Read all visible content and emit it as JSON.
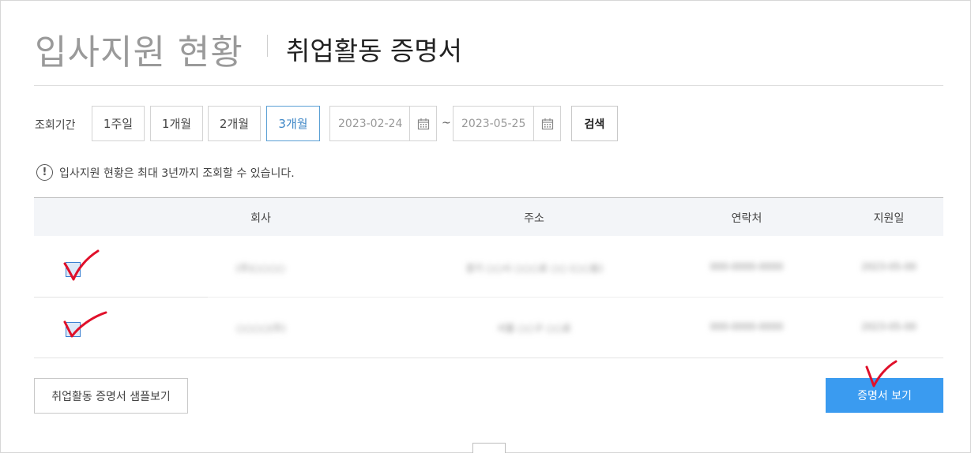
{
  "header": {
    "title": "입사지원 현황",
    "subtitle": "취업활동 증명서"
  },
  "filter": {
    "period_label": "조회기간",
    "periods": [
      "1주일",
      "1개월",
      "2개월",
      "3개월"
    ],
    "active_period": "3개월",
    "start_date": "2023-02-24",
    "end_date": "2023-05-25",
    "separator": "~",
    "search_label": "검색"
  },
  "notice": {
    "icon": "info-icon",
    "text": "입사지원 현황은 최대 3년까지 조회할 수 있습니다."
  },
  "table": {
    "headers": [
      "회사",
      "주소",
      "연락처",
      "지원일"
    ],
    "rows": [
      {
        "checked": true,
        "company": "(주)○○○○",
        "address": "경기 ○○시 ○○○로 ○○ (○○동)",
        "phone": "000-0000-0000",
        "date": "2023-05-00"
      },
      {
        "checked": true,
        "company": "○○○○(주)",
        "address": "서울 ○○구 ○○로",
        "phone": "000-0000-0000",
        "date": "2023-05-00"
      }
    ]
  },
  "actions": {
    "sample_label": "취업활동 증명서 샘플보기",
    "view_label": "증명서 보기"
  },
  "colors": {
    "accent": "#3a9bf0",
    "active_border": "#5a9fd4",
    "mark": "#e0102a"
  }
}
